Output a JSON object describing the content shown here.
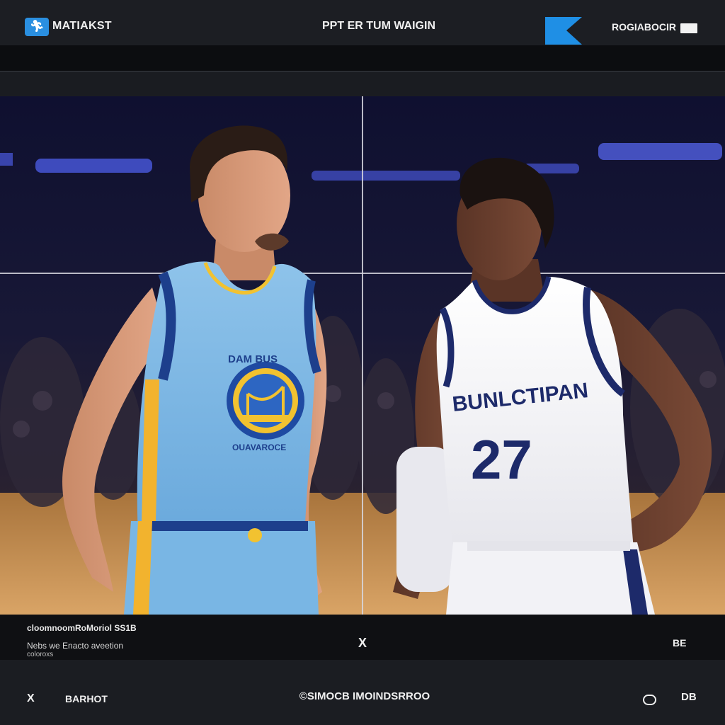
{
  "header": {
    "logo_icon": "runner-icon",
    "app_name": "MATIAKST",
    "center_title": "PPT ER TUM WAIGIN",
    "account_label": "ROGIABOCIR"
  },
  "viewer": {
    "left_jersey_text": "DAM BUS",
    "left_jersey_bottom": "OUAVAROCE",
    "right_jersey_text": "BUNLCTIPAN",
    "right_jersey_number": "27"
  },
  "info": {
    "line1": "cloomnoomRoMoriol SS1B",
    "line2": "Nebs we Enacto aveetion",
    "line3": "coloroxs",
    "close_label": "X",
    "right_label": "BE"
  },
  "footer": {
    "left_icon_label": "X",
    "left_label": "BARHOT",
    "center_label": "SIMOCB IMOINDSRROO",
    "right_label": "DB"
  },
  "colors": {
    "accent": "#1f8fe5",
    "background": "#15171c",
    "bar": "#1c1e23"
  }
}
